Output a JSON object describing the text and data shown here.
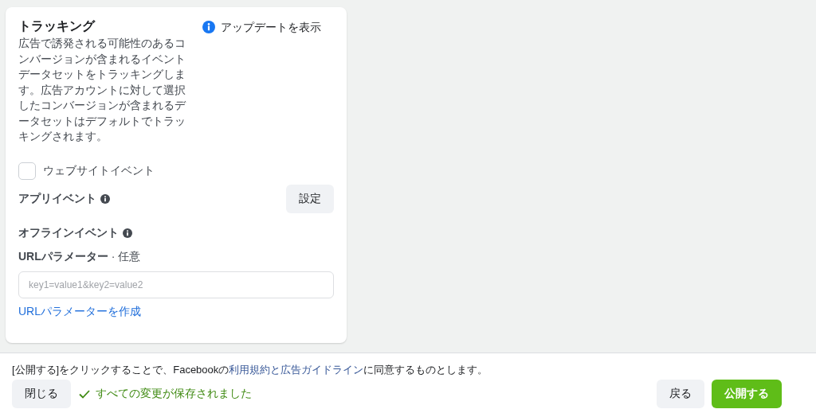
{
  "tracking": {
    "title": "トラッキング",
    "description": "広告で誘発される可能性のあるコンバージョンが含まれるイベントデータセットをトラッキングします。広告アカウントに対して選択したコンバージョンが含まれるデータセットはデフォルトでトラッキングされます。",
    "updates_link": "アップデートを表示",
    "website_events": {
      "label": "ウェブサイトイベント",
      "checked": false
    },
    "app_events": {
      "label": "アプリイベント",
      "button": "設定"
    },
    "offline_events": {
      "label": "オフラインイベント"
    },
    "url_parameters": {
      "label": "URLパラメーター",
      "optional": "· 任意",
      "placeholder": "key1=value1&key2=value2",
      "create_link": "URLパラメーターを作成"
    }
  },
  "footer": {
    "terms_before": "[公開する]をクリックすることで、Facebookの",
    "terms_link": "利用規約と広告ガイドライン",
    "terms_after": "に同意するものとします。",
    "close_button": "閉じる",
    "status": "すべての変更が保存されました",
    "back_button": "戻る",
    "publish_button": "公開する"
  }
}
